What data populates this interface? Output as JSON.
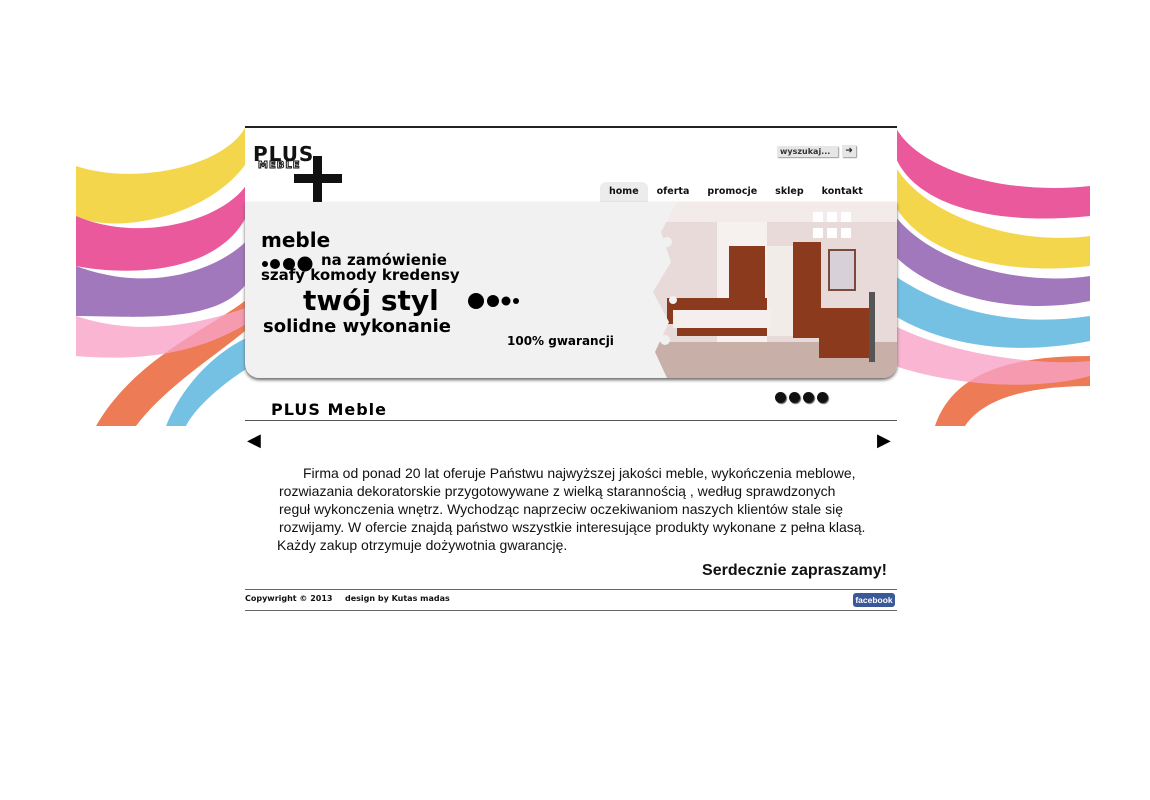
{
  "header": {
    "logo_main": "PLUS",
    "logo_sub": "MEBLE",
    "search_placeholder": "wyszukaj...",
    "search_button_symbol": "➜"
  },
  "nav": {
    "items": [
      {
        "label": "home",
        "active": true
      },
      {
        "label": "oferta",
        "active": false
      },
      {
        "label": "promocje",
        "active": false
      },
      {
        "label": "sklep",
        "active": false
      },
      {
        "label": "kontakt",
        "active": false
      }
    ]
  },
  "banner": {
    "line1": "meble",
    "line2": "na zamówienie",
    "line3": "szafy komody kredensy",
    "line4": "twój styl",
    "line5": "solidne wykonanie",
    "line6": "100% gwarancji"
  },
  "slider": {
    "dot_count": 4
  },
  "main": {
    "title": "PLUS Meble",
    "arrow_left": "◀",
    "arrow_right": "▶",
    "paragraph_lines": [
      "Firma od ponad 20 lat oferuje Państwu najwyższej jakości meble, wykończenia meblowe,",
      "rozwiazania dekoratorskie przygotowywane z wielką starannością , według sprawdzonych",
      "reguł wykonczenia wnętrz. Wychodząc naprzeciw oczekiwaniom naszych klientów stale się",
      "rozwijamy. W ofercie znajdą państwo wszystkie interesujące produkty wykonane z pełna klasą.",
      "Każdy zakup otrzymuje dożywotnia gwarancję."
    ],
    "closing": "Serdecznie zapraszamy!"
  },
  "footer": {
    "copyright": "Copywright © 2013",
    "design": "design by Kutas madas",
    "facebook_label": "facebook"
  },
  "colors": {
    "text": "#111111",
    "banner_bg": "#f1f1f1",
    "facebook": "#3b5998",
    "wood": "#8b3a1e"
  }
}
